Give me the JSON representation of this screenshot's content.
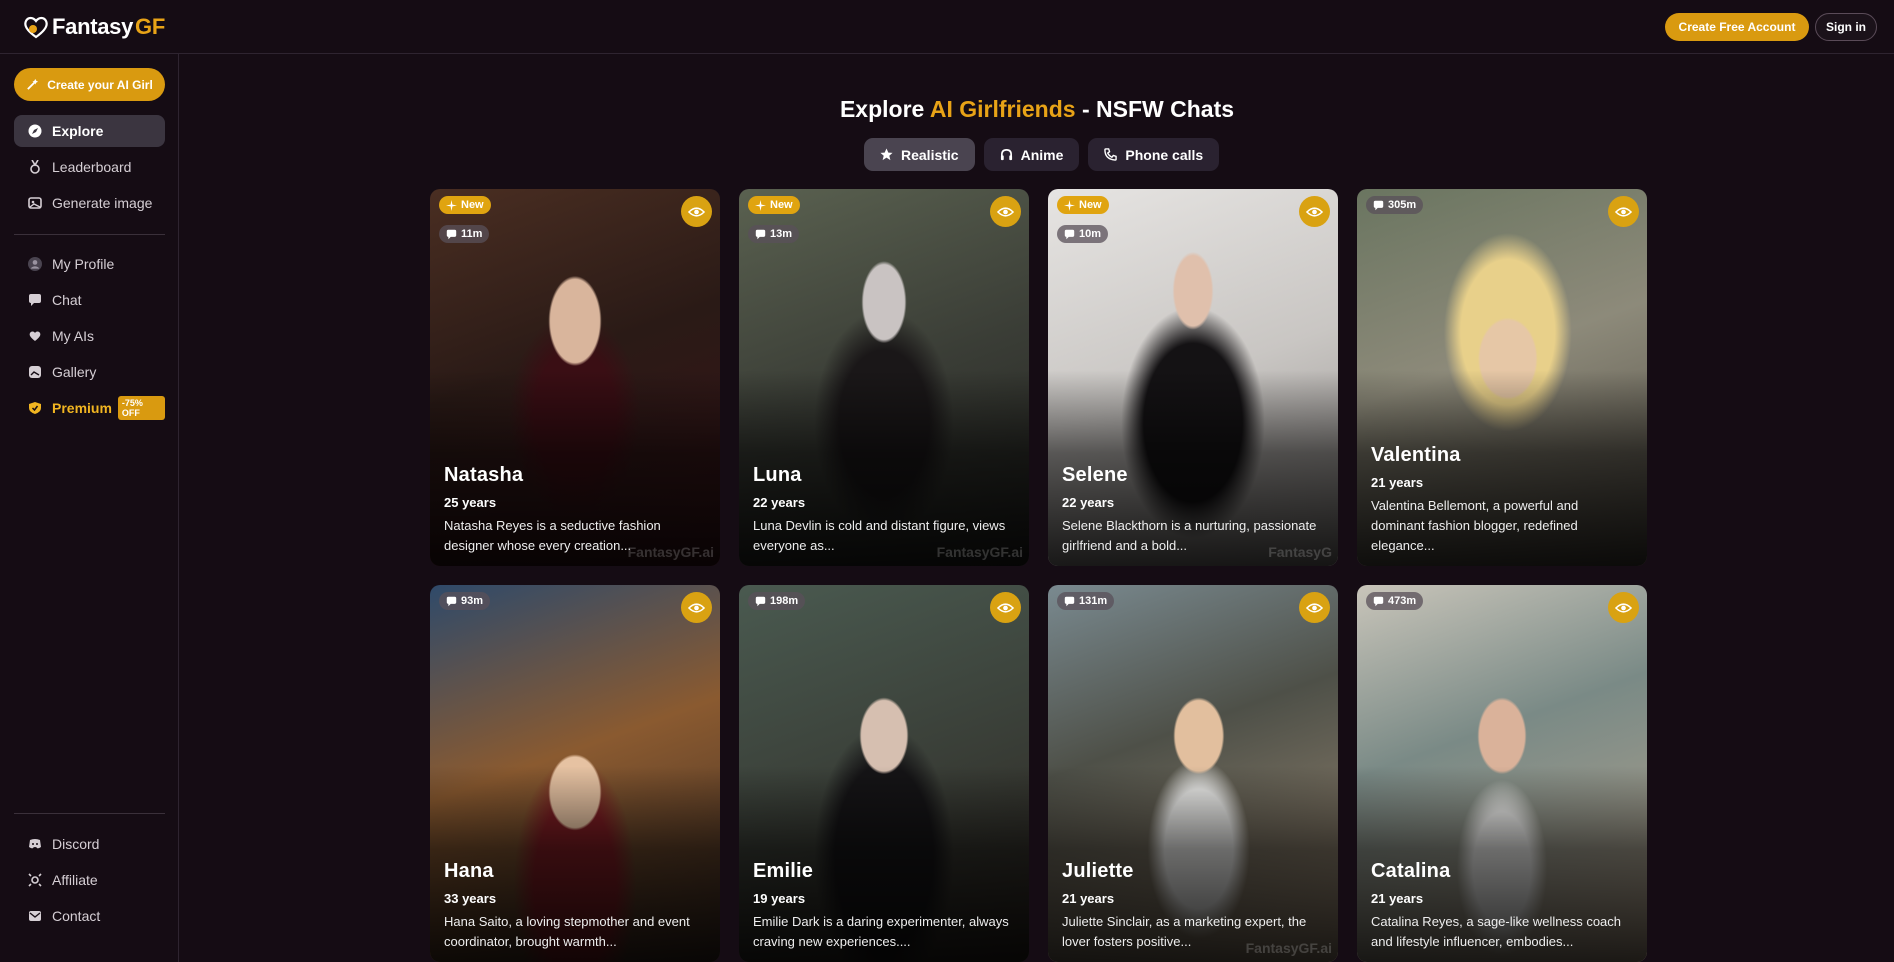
{
  "header": {
    "logo_text_a": "Fantasy",
    "logo_text_b": "GF",
    "create_account": "Create Free Account",
    "sign_in": "Sign in"
  },
  "sidebar": {
    "create_button": "Create your AI Girl",
    "items": [
      {
        "label": "Explore",
        "icon": "compass-icon"
      },
      {
        "label": "Leaderboard",
        "icon": "medal-icon"
      },
      {
        "label": "Generate image",
        "icon": "image-icon"
      },
      {
        "label": "My Profile",
        "icon": "user-icon"
      },
      {
        "label": "Chat",
        "icon": "chat-icon"
      },
      {
        "label": "My AIs",
        "icon": "heart-users-icon"
      },
      {
        "label": "Gallery",
        "icon": "gallery-icon"
      },
      {
        "label": "Premium",
        "icon": "shield-icon",
        "badge": "-75% OFF"
      }
    ],
    "footer_items": [
      {
        "label": "Discord",
        "icon": "discord-icon"
      },
      {
        "label": "Affiliate",
        "icon": "affiliate-icon"
      },
      {
        "label": "Contact",
        "icon": "mail-icon"
      }
    ]
  },
  "main": {
    "title_a": "Explore ",
    "title_accent": "AI Girlfriends",
    "title_b": " - NSFW Chats",
    "tabs": [
      {
        "label": "Realistic",
        "icon": "star-icon"
      },
      {
        "label": "Anime",
        "icon": "headphones-icon"
      },
      {
        "label": "Phone calls",
        "icon": "phone-icon"
      }
    ],
    "cards": [
      {
        "name": "Natasha",
        "age": "25 years",
        "desc": "Natasha Reyes is a seductive fashion designer whose every creation...",
        "new": "New",
        "count": "11m",
        "wm": "FantasyGF.ai"
      },
      {
        "name": "Luna",
        "age": "22 years",
        "desc": "Luna Devlin is cold and distant figure, views everyone as...",
        "new": "New",
        "count": "13m",
        "wm": "FantasyGF.ai"
      },
      {
        "name": "Selene",
        "age": "22 years",
        "desc": "Selene Blackthorn is a nurturing, passionate girlfriend and a bold...",
        "new": "New",
        "count": "10m",
        "wm": "FantasyG"
      },
      {
        "name": "Valentina",
        "age": "21 years",
        "desc": "Valentina Bellemont, a powerful and dominant fashion blogger, redefined elegance...",
        "new": "",
        "count": "305m",
        "wm": ""
      },
      {
        "name": "Hana",
        "age": "33 years",
        "desc": "Hana Saito, a loving stepmother and event coordinator, brought warmth...",
        "new": "",
        "count": "93m",
        "wm": ""
      },
      {
        "name": "Emilie",
        "age": "19 years",
        "desc": "Emilie Dark is a daring experimenter, always craving new experiences....",
        "new": "",
        "count": "198m",
        "wm": ""
      },
      {
        "name": "Juliette",
        "age": "21 years",
        "desc": "Juliette Sinclair, as a marketing expert, the lover fosters positive...",
        "new": "",
        "count": "131m",
        "wm": "FantasyGF.ai"
      },
      {
        "name": "Catalina",
        "age": "21 years",
        "desc": "Catalina Reyes, a sage-like wellness coach and lifestyle influencer, embodies...",
        "new": "",
        "count": "473m",
        "wm": ""
      }
    ]
  },
  "colors": {
    "accent": "#d99a10",
    "background": "#150c14"
  }
}
